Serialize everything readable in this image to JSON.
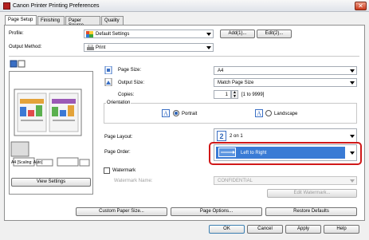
{
  "window": {
    "title": "Canon Printer Printing Preferences",
    "close_label": "✕"
  },
  "tabs": [
    {
      "label": "Page Setup",
      "active": true
    },
    {
      "label": "Finishing",
      "active": false
    },
    {
      "label": "Paper Source",
      "active": false
    },
    {
      "label": "Quality",
      "active": false
    }
  ],
  "profile": {
    "label": "Profile:",
    "value": "Default Settings",
    "add_label": "Add(1)...",
    "edit_label": "Edit(2)..."
  },
  "output_method": {
    "label": "Output Method:",
    "value": "Print"
  },
  "page_size": {
    "label": "Page Size:",
    "value": "A4"
  },
  "output_size": {
    "label": "Output Size:",
    "value": "Match Page Size"
  },
  "copies": {
    "label": "Copies:",
    "value": "1",
    "range": "[1 to 9999]"
  },
  "orientation": {
    "label": "Orientation",
    "portrait": "Portrait",
    "landscape": "Landscape",
    "selected": "Portrait"
  },
  "page_layout": {
    "label": "Page Layout:",
    "value": "2 on 1",
    "icon_number": "2"
  },
  "page_order": {
    "label": "Page Order:",
    "value": "Left to Right"
  },
  "watermark": {
    "label": "Watermark",
    "checked": false,
    "name_label": "Watermark Name:",
    "name_value": "CONFIDENTIAL",
    "edit_label": "Edit Watermark..."
  },
  "preview": {
    "caption": "A4 [Scaling: Auto]",
    "view_settings_label": "View Settings"
  },
  "bottom_buttons": {
    "custom_paper_size": "Custom Paper Size...",
    "page_options": "Page Options...",
    "restore_defaults": "Restore Defaults"
  },
  "dialog_buttons": {
    "ok": "OK",
    "cancel": "Cancel",
    "apply": "Apply",
    "help": "Help"
  },
  "colors": {
    "accent_red": "#d01818",
    "selection_blue": "#3a7bd5"
  }
}
